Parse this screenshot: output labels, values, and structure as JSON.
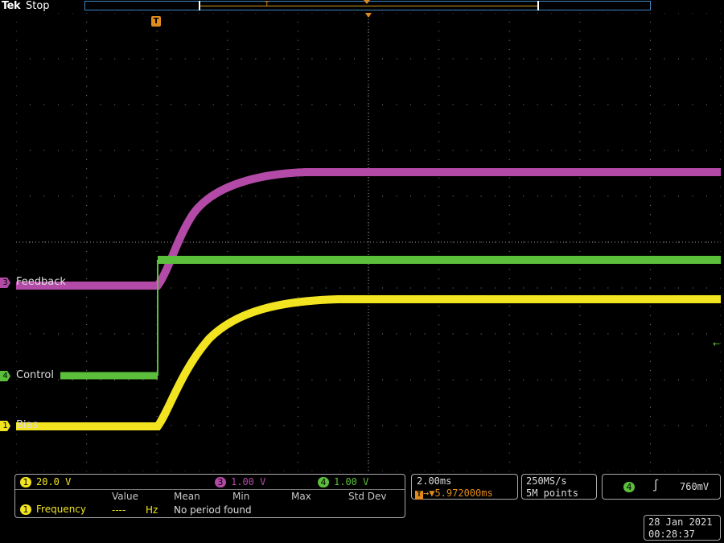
{
  "header": {
    "brand": "Tek",
    "acquisition_status": "Stop",
    "trigger_marker": "T"
  },
  "waveforms": {
    "ch3": {
      "label": "Feedback",
      "number": "3",
      "color": "#b44aa8"
    },
    "ch4": {
      "label": "Control",
      "number": "4",
      "color": "#5cbf3c"
    },
    "ch1": {
      "label": "Bias",
      "number": "1",
      "color": "#f2e420"
    }
  },
  "channel_scales": [
    {
      "number": "1",
      "value": "20.0 V",
      "color": "#f2e420"
    },
    {
      "number": "3",
      "value": "1.00 V",
      "color": "#b44aa8"
    },
    {
      "number": "4",
      "value": "1.00 V",
      "color": "#5cbf3c"
    }
  ],
  "measurement_table": {
    "headers": [
      "Value",
      "Mean",
      "Min",
      "Max",
      "Std Dev"
    ],
    "row": {
      "channel": "1",
      "name": "Frequency",
      "value": "----",
      "unit": "Hz",
      "message": "No period found"
    }
  },
  "timebase": {
    "scale": "2.00ms",
    "trigger_position_prefix": "T",
    "position": "5.972000ms"
  },
  "acquisition": {
    "sample_rate": "250MS/s",
    "record_length": "5M points"
  },
  "trigger": {
    "source": "4",
    "slope_symbol": "∫",
    "level": "760mV"
  },
  "datetime": {
    "date": "28 Jan  2021",
    "time": "00:28:37"
  },
  "colors": {
    "graticule": "#8a8a8a",
    "trigger_orange": "#e08b1e",
    "record_blue": "#3f87c2"
  }
}
